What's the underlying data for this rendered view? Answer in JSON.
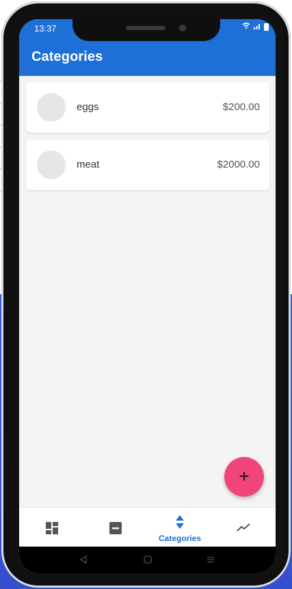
{
  "status_bar": {
    "time": "13:37",
    "icons": [
      "sync-icon",
      "wifi-icon",
      "signal-icon",
      "battery-icon"
    ]
  },
  "app_bar": {
    "title": "Categories"
  },
  "categories": [
    {
      "name": "eggs",
      "amount": "$200.00"
    },
    {
      "name": "meat",
      "amount": "$2000.00"
    }
  ],
  "fab": {
    "label": "+"
  },
  "bottom_nav": {
    "items": [
      {
        "icon": "dashboard-icon",
        "label": ""
      },
      {
        "icon": "minus-box-icon",
        "label": ""
      },
      {
        "icon": "sort-arrows-icon",
        "label": "Categories",
        "active": true
      },
      {
        "icon": "trend-icon",
        "label": ""
      }
    ]
  },
  "system_nav": {
    "icons": [
      "back-icon",
      "home-icon",
      "menu-icon"
    ]
  },
  "colors": {
    "primary": "#1e6fd8",
    "fab": "#f1457a",
    "background": "#f4f4f4"
  }
}
